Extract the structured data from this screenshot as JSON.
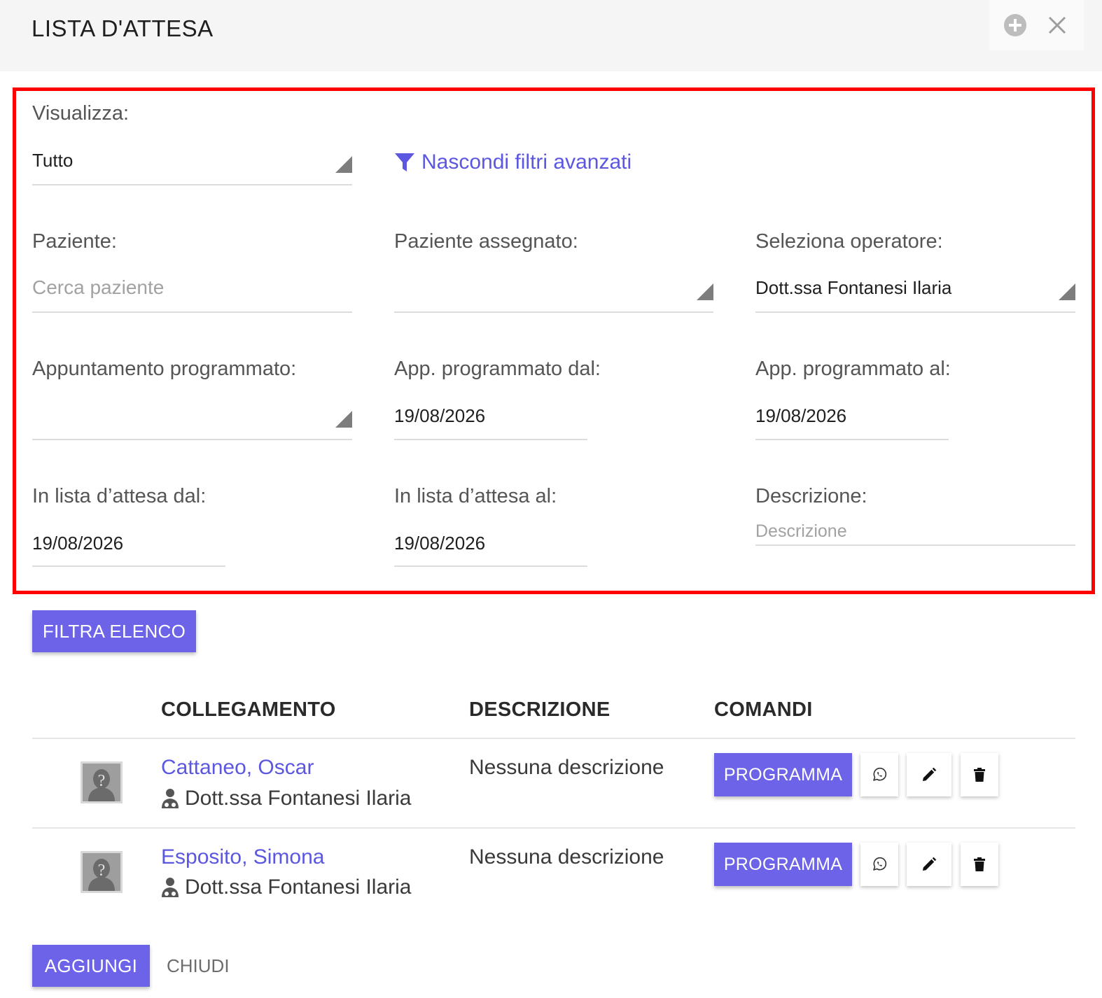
{
  "header": {
    "title": "LISTA D'ATTESA",
    "add_icon": "plus-circle-icon",
    "close_icon": "close-x-icon"
  },
  "filters": {
    "visualizza": {
      "label": "Visualizza:",
      "value": "Tutto"
    },
    "advanced_link": "Nascondi filtri avanzati",
    "paziente": {
      "label": "Paziente:",
      "placeholder": "Cerca paziente"
    },
    "paziente_assegnato": {
      "label": "Paziente assegnato:",
      "value": ""
    },
    "operatore": {
      "label": "Seleziona operatore:",
      "value": "Dott.ssa Fontanesi Ilaria"
    },
    "appuntamento": {
      "label": "Appuntamento programmato:",
      "value": ""
    },
    "app_dal": {
      "label": "App. programmato dal:",
      "value": "19/08/2026"
    },
    "app_al": {
      "label": "App. programmato al:",
      "value": "19/08/2026"
    },
    "lista_dal": {
      "label": "In lista d’attesa dal:",
      "value": "19/08/2026"
    },
    "lista_al": {
      "label": "In lista d’attesa al:",
      "value": "19/08/2026"
    },
    "descrizione": {
      "label": "Descrizione:",
      "placeholder": "Descrizione"
    }
  },
  "filter_button": "FILTRA ELENCO",
  "table": {
    "columns": [
      "COLLEGAMENTO",
      "DESCRIZIONE",
      "COMANDI"
    ],
    "rows": [
      {
        "patient": "Cattaneo, Oscar",
        "operator": "Dott.ssa Fontanesi Ilaria",
        "description": "Nessuna descrizione",
        "action": "PROGRAMMA"
      },
      {
        "patient": "Esposito, Simona",
        "operator": "Dott.ssa Fontanesi Ilaria",
        "description": "Nessuna descrizione",
        "action": "PROGRAMMA"
      }
    ]
  },
  "footer": {
    "add_label": "AGGIUNGI",
    "close_label": "CHIUDI"
  },
  "colors": {
    "accent": "#6c63e8",
    "link": "#5b57e0",
    "highlight_border": "#ff0000",
    "header_bg": "#f5f5f5"
  }
}
